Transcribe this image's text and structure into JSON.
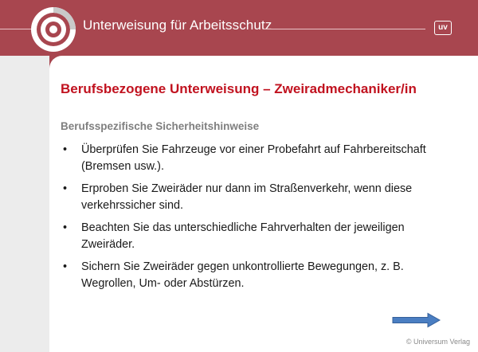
{
  "header": {
    "title": "Unterweisung für Arbeitsschutz",
    "badge": "uv",
    "logo_icon": "circular-target-logo-icon"
  },
  "slide": {
    "title": "Berufsbezogene Unterweisung – Zweiradmechaniker/in",
    "subtitle": "Berufsspezifische Sicherheitshinweise",
    "bullet_symbol": "•",
    "bullets": [
      "Überprüfen Sie Fahrzeuge vor einer Probefahrt auf Fahrbereitschaft (Bremsen usw.).",
      "Erproben Sie Zweiräder nur dann im Straßenverkehr, wenn diese verkehrssicher sind.",
      "Beachten Sie das unterschiedliche Fahrverhalten der jeweiligen Zweiräder.",
      "Sichern Sie Zweiräder gegen unkontrollierte Bewegungen, z. B. Wegrollen, Um- oder Abstürzen."
    ]
  },
  "navigation": {
    "next_icon": "arrow-right-icon"
  },
  "footer": {
    "copyright": "© Universum Verlag"
  },
  "colors": {
    "header_bg": "#a8464f",
    "title_red": "#c1121f",
    "subtitle_gray": "#7f7f7f",
    "arrow_blue": "#4a7ec2"
  }
}
